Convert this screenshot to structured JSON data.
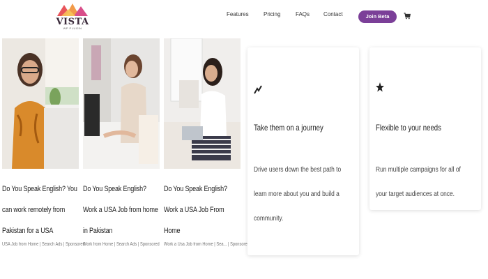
{
  "brand": {
    "name": "VISTA",
    "tagline": "WP PLUGIN"
  },
  "nav": {
    "features": "Features",
    "pricing": "Pricing",
    "faqs": "FAQs",
    "contact": "Contact",
    "cta": "Join Beta"
  },
  "icons": {
    "cart": "cart-icon",
    "journey": "trend-up-icon",
    "flexible": "star-icon"
  },
  "colors": {
    "accent": "#7b3f98"
  },
  "articles": [
    {
      "title": "Do You Speak English? You can work remotely from Pakistan for a USA employer",
      "meta": "USA Job from Home | Search Ads | Sponsored"
    },
    {
      "title": "Do You Speak English? Work a USA Job from home in Pakistan",
      "meta": "Work from Home | Search Ads | Sponsored"
    },
    {
      "title": "Do You Speak English? Work a USA Job From Home",
      "meta": "Work a Usa Job from Home | Sea... | Sponsored"
    }
  ],
  "features": [
    {
      "title": "Take them on a journey",
      "text": "Drive users down the best path to learn more about you and build a community."
    },
    {
      "title": "Flexible to your needs",
      "text": "Run multiple campaigns for all of your target audiences at once."
    }
  ]
}
